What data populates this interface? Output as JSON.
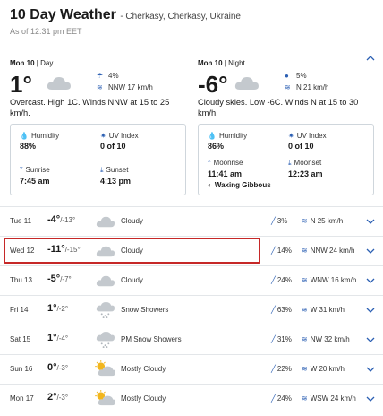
{
  "header": {
    "title": "10 Day Weather",
    "location": "- Cherkasy, Cherkasy, Ukraine",
    "as_of": "As of 12:31 pm EET"
  },
  "day_panel": {
    "date": "Mon 10",
    "sep": " | ",
    "period": "Day",
    "temp": "1°",
    "precip": "4%",
    "wind": "NNW 17 km/h",
    "description": "Overcast. High 1C. Winds NNW at 15 to 25 km/h.",
    "humidity_label": "Humidity",
    "humidity": "88%",
    "uv_label": "UV Index",
    "uv": "0 of 10",
    "sunrise_label": "Sunrise",
    "sunrise": "7:45 am",
    "sunset_label": "Sunset",
    "sunset": "4:13 pm"
  },
  "night_panel": {
    "date": "Mon 10",
    "sep": " | ",
    "period": "Night",
    "temp": "-6°",
    "precip": "5%",
    "wind": "N 21 km/h",
    "description": "Cloudy skies. Low -6C. Winds N at 15 to 30 km/h.",
    "humidity_label": "Humidity",
    "humidity": "86%",
    "uv_label": "UV Index",
    "uv": "0 of 10",
    "moonrise_label": "Moonrise",
    "moonrise": "11:41 am",
    "moonset_label": "Moonset",
    "moonset": "12:23 am",
    "moon_phase": "Waxing Gibbous"
  },
  "rows": [
    {
      "day": "Tue 11",
      "hi": "-4°",
      "lo": "/-13°",
      "cond": "Cloudy",
      "icon": "cloud-icon",
      "precip": "3%",
      "wind": "N 25 km/h"
    },
    {
      "day": "Wed 12",
      "hi": "-11°",
      "lo": "/-15°",
      "cond": "Cloudy",
      "icon": "cloud-icon",
      "precip": "14%",
      "wind": "NNW 24 km/h"
    },
    {
      "day": "Thu 13",
      "hi": "-5°",
      "lo": "/-7°",
      "cond": "Cloudy",
      "icon": "cloud-icon",
      "precip": "24%",
      "wind": "WNW 16 km/h"
    },
    {
      "day": "Fri 14",
      "hi": "1°",
      "lo": "/-2°",
      "cond": "Snow Showers",
      "icon": "snow-cloud-icon",
      "precip": "63%",
      "wind": "W 31 km/h"
    },
    {
      "day": "Sat 15",
      "hi": "1°",
      "lo": "/-4°",
      "cond": "PM Snow Showers",
      "icon": "snow-cloud-icon",
      "precip": "31%",
      "wind": "NW 32 km/h"
    },
    {
      "day": "Sun 16",
      "hi": "0°",
      "lo": "/-3°",
      "cond": "Mostly Cloudy",
      "icon": "sun-cloud-icon",
      "precip": "22%",
      "wind": "W 20 km/h"
    },
    {
      "day": "Mon 17",
      "hi": "2°",
      "lo": "/-3°",
      "cond": "Mostly Cloudy",
      "icon": "sun-cloud-icon",
      "precip": "24%",
      "wind": "WSW 24 km/h"
    }
  ],
  "colors": {
    "accent": "#2b5fb3",
    "highlight": "#c62828",
    "cloud": "#c4c9ce"
  }
}
